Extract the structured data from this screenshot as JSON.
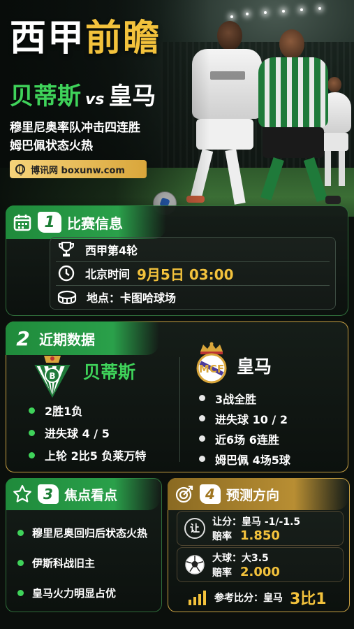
{
  "hero": {
    "title_white": "西甲",
    "title_gold": "前瞻",
    "home_team": "贝蒂斯",
    "vs": "vs",
    "away_team": "皇马",
    "subtitle_1": "穆里尼奥率队冲击四连胜",
    "subtitle_2": "姆巴佩状态火热",
    "site_label": "博讯网 boxunw.com"
  },
  "section1": {
    "num": "1",
    "title": "比赛信息",
    "round": "西甲第4轮",
    "time_prefix": "北京时间",
    "date": "9月5日",
    "time": "03:00",
    "venue": "地点：卡图哈球场",
    "icons": [
      "calendar-icon",
      "trophy-icon",
      "clock-icon",
      "stadium-icon"
    ]
  },
  "section2": {
    "num": "2",
    "title": "近期数据",
    "home": {
      "name": "贝蒂斯",
      "stats": [
        "2胜1负",
        "进失球 4 / 5",
        "上轮 2比5 负莱万特"
      ]
    },
    "away": {
      "name": "皇马",
      "stats": [
        "3战全胜",
        "进失球 10 / 2",
        "近6场 6连胜",
        "姆巴佩 4场5球"
      ]
    }
  },
  "section3": {
    "num": "3",
    "title": "焦点看点",
    "points": [
      "穆里尼奥回归后状态火热",
      "伊斯科战旧主",
      "皇马火力明显占优"
    ]
  },
  "section4": {
    "num": "4",
    "title": "预测方向",
    "handicap_icon_text": "让",
    "handicap_label": "让分：皇马 -1/-1.5",
    "handicap_odds_label": "赔率",
    "handicap_odds": "1.850",
    "total_label": "大球：大3.5",
    "total_odds_label": "赔率",
    "total_odds": "2.000",
    "score_label": "参考比分：皇马",
    "score_value": "3比1"
  },
  "colors": {
    "accent_green": "#3fd35a",
    "accent_gold": "#f3c23c",
    "panel_green_border": "#2f6d3a",
    "panel_gold_border": "#c7a043"
  }
}
